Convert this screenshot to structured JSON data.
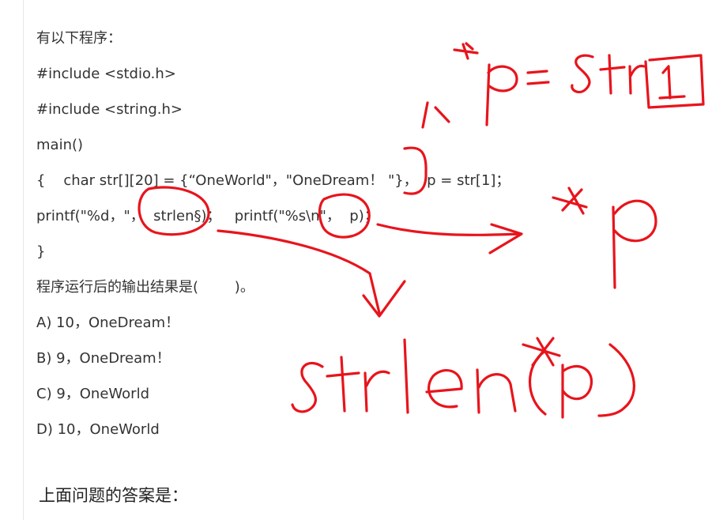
{
  "question": {
    "lines": [
      "有以下程序：",
      "#include <stdio.h>",
      "#include <string.h>",
      "main()",
      "{    char str[][20] = {“OneWorld\"，\"OneDream！ \"}，  p = str[1]；",
      "printf(\"%d，\"，  strlen§)；   printf(\"%s\\n\"，  p)；",
      "}",
      "程序运行后的输出结果是(        )。",
      "A) 10，OneDream！",
      "B) 9，OneDream！",
      "C) 9，OneWorld",
      "D) 10，OneWorld"
    ]
  },
  "answer_heading": "上面问题的答案是：",
  "annotations": {
    "color": "#e8141c",
    "notes": [
      "*p = str[1]",
      "*p",
      "strlen(*p)"
    ]
  }
}
